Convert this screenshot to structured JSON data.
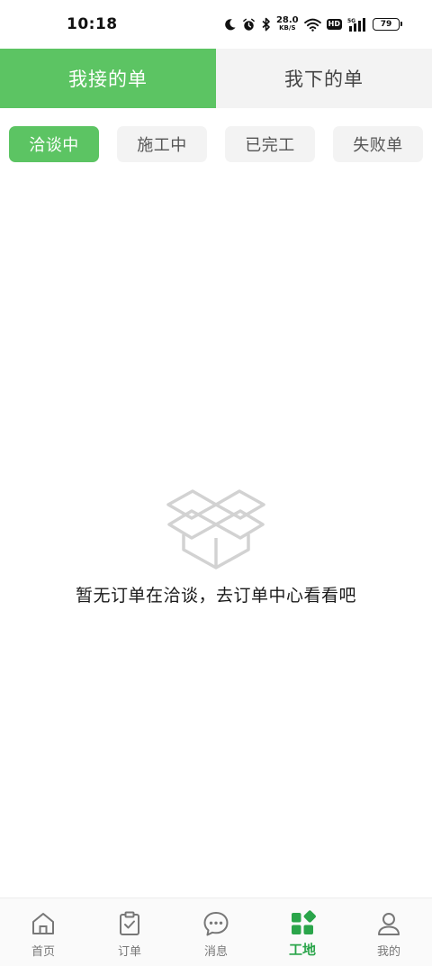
{
  "status_bar": {
    "time": "10:18",
    "net_speed_value": "28.0",
    "net_speed_unit": "KB/S",
    "hd_label": "HD",
    "signal_label": "5G",
    "battery_level": "79",
    "icons": [
      "moon-icon",
      "alarm-icon",
      "bluetooth-icon",
      "wifi-icon",
      "signal-icon",
      "battery-icon"
    ]
  },
  "main_tabs": [
    {
      "label": "我接的单",
      "active": true
    },
    {
      "label": "我下的单",
      "active": false
    }
  ],
  "sub_tabs": [
    {
      "label": "洽谈中",
      "active": true
    },
    {
      "label": "施工中",
      "active": false
    },
    {
      "label": "已完工",
      "active": false
    },
    {
      "label": "失败单",
      "active": false
    }
  ],
  "empty_state": {
    "icon": "empty-box-icon",
    "message": "暂无订单在洽谈，去订单中心看看吧"
  },
  "bottom_nav": [
    {
      "label": "首页",
      "icon": "home-icon",
      "active": false
    },
    {
      "label": "订单",
      "icon": "clipboard-check-icon",
      "active": false
    },
    {
      "label": "消息",
      "icon": "chat-bubble-icon",
      "active": false
    },
    {
      "label": "工地",
      "icon": "grid-blocks-icon",
      "active": true
    },
    {
      "label": "我的",
      "icon": "user-icon",
      "active": false
    }
  ],
  "colors": {
    "accent": "#5cc463",
    "nav_active": "#2aa54a",
    "inactive_bg": "#f3f3f3"
  }
}
